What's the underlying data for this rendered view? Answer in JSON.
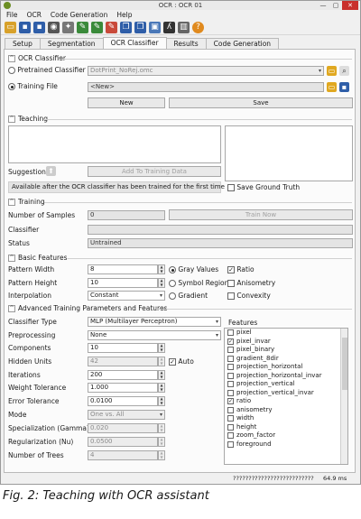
{
  "window": {
    "title": "OCR : OCR 01",
    "minimize": "—",
    "maximize": "▢",
    "close": "✕"
  },
  "menu": [
    "File",
    "OCR",
    "Code Generation",
    "Help"
  ],
  "toolbar_icons": [
    "open-folder-icon",
    "save-icon",
    "save-all-icon",
    "camera-icon",
    "tools-icon",
    "draw-icon",
    "edit-icon",
    "erase-icon",
    "copy-icon",
    "paste-icon",
    "window-icon",
    "chart-icon",
    "histogram-icon",
    "help-icon"
  ],
  "tabs": [
    "Setup",
    "Segmentation",
    "OCR Classifier",
    "Results",
    "Code Generation"
  ],
  "active_tab": "OCR Classifier",
  "ocr_classifier": {
    "header": "OCR Classifier",
    "pretrained_label": "Pretrained Classifier",
    "pretrained_value": "DotPrint_NoRej.omc",
    "training_label": "Training File",
    "training_value": "<New>",
    "new_button": "New",
    "save_button": "Save"
  },
  "teaching": {
    "header": "Teaching",
    "suggestion_label": "Suggestion",
    "add_button": "Add To Training Data",
    "info_text": "Available after the OCR classifier has been trained for the first time",
    "save_ground_truth": "Save Ground Truth"
  },
  "training": {
    "header": "Training",
    "samples_label": "Number of Samples",
    "samples_value": "0",
    "train_button": "Train Now",
    "classifier_label": "Classifier",
    "classifier_value": "",
    "status_label": "Status",
    "status_value": "Untrained"
  },
  "basic": {
    "header": "Basic Features",
    "width_label": "Pattern Width",
    "width_value": "8",
    "height_label": "Pattern Height",
    "height_value": "10",
    "interp_label": "Interpolation",
    "interp_value": "Constant",
    "gray_values": "Gray Values",
    "symbol_region": "Symbol Region",
    "gradient": "Gradient",
    "ratio": "Ratio",
    "anisometry": "Anisometry",
    "convexity": "Convexity"
  },
  "advanced": {
    "header": "Advanced Training Parameters and Features",
    "classifier_type_label": "Classifier Type",
    "classifier_type_value": "MLP (Multilayer Perceptron)",
    "preproc_label": "Preprocessing",
    "preproc_value": "None",
    "components_label": "Components",
    "components_value": "10",
    "hidden_label": "Hidden Units",
    "hidden_value": "42",
    "auto_label": "Auto",
    "iterations_label": "Iterations",
    "iterations_value": "200",
    "weight_label": "Weight Tolerance",
    "weight_value": "1.000",
    "error_label": "Error Tolerance",
    "error_value": "0.0100",
    "mode_label": "Mode",
    "mode_value": "One vs. All",
    "gamma_label": "Specialization (Gamma)",
    "gamma_value": "0.020",
    "nu_label": "Regularization (Nu)",
    "nu_value": "0.0500",
    "trees_label": "Number of Trees",
    "trees_value": "4",
    "features_label": "Features",
    "features": [
      {
        "name": "pixel",
        "checked": false
      },
      {
        "name": "pixel_invar",
        "checked": true
      },
      {
        "name": "pixel_binary",
        "checked": false
      },
      {
        "name": "gradient_8dir",
        "checked": false
      },
      {
        "name": "projection_horizontal",
        "checked": false
      },
      {
        "name": "projection_horizontal_invar",
        "checked": false
      },
      {
        "name": "projection_vertical",
        "checked": false
      },
      {
        "name": "projection_vertical_invar",
        "checked": false
      },
      {
        "name": "ratio",
        "checked": true
      },
      {
        "name": "anisometry",
        "checked": false
      },
      {
        "name": "width",
        "checked": false
      },
      {
        "name": "height",
        "checked": false
      },
      {
        "name": "zoom_factor",
        "checked": false
      },
      {
        "name": "foreground",
        "checked": false
      }
    ]
  },
  "status": {
    "text": "??????????????????????????",
    "time": "64.9 ms"
  },
  "caption": "Fig. 2: Teaching with OCR assistant"
}
